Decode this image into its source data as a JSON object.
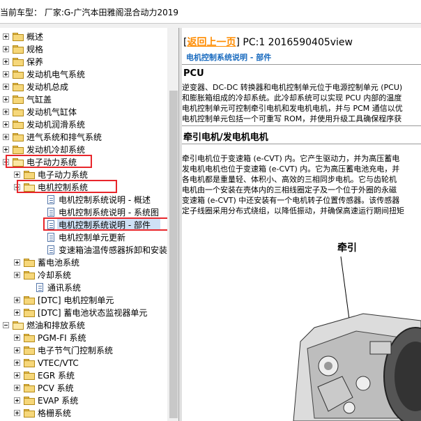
{
  "window": {
    "title": "当前车型： 厂家:G-广汽本田雅阁混合动力2019"
  },
  "tree": [
    {
      "label": "概述",
      "type": "folder",
      "expander": "plus",
      "depth": 0
    },
    {
      "label": "规格",
      "type": "folder",
      "expander": "plus",
      "depth": 0
    },
    {
      "label": "保养",
      "type": "folder",
      "expander": "plus",
      "depth": 0
    },
    {
      "label": "发动机电气系统",
      "type": "folder",
      "expander": "plus",
      "depth": 0
    },
    {
      "label": "发动机总成",
      "type": "folder",
      "expander": "plus",
      "depth": 0
    },
    {
      "label": "气缸盖",
      "type": "folder",
      "expander": "plus",
      "depth": 0
    },
    {
      "label": "发动机气缸体",
      "type": "folder",
      "expander": "plus",
      "depth": 0
    },
    {
      "label": "发动机润滑系统",
      "type": "folder",
      "expander": "plus",
      "depth": 0
    },
    {
      "label": "进气系统和排气系统",
      "type": "folder",
      "expander": "plus",
      "depth": 0
    },
    {
      "label": "发动机冷却系统",
      "type": "folder",
      "expander": "plus",
      "depth": 0
    },
    {
      "label": "电子动力系统",
      "type": "folder",
      "expander": "minus",
      "depth": 0,
      "open": true,
      "boxed": true
    },
    {
      "label": "电子动力系统",
      "type": "folder",
      "expander": "plus",
      "depth": 1
    },
    {
      "label": "电机控制系统",
      "type": "folder",
      "expander": "minus",
      "depth": 1,
      "open": true,
      "boxed": true
    },
    {
      "label": "电机控制系统说明 - 概述",
      "type": "doc",
      "depth": 2
    },
    {
      "label": "电机控制系统说明 - 系统图",
      "type": "doc",
      "depth": 2
    },
    {
      "label": "电机控制系统说明 - 部件",
      "type": "doc",
      "depth": 2,
      "selected": true,
      "boxed": true
    },
    {
      "label": "电机控制单元更新",
      "type": "doc",
      "depth": 2
    },
    {
      "label": "变速箱油温传感器拆卸和安装",
      "type": "doc",
      "depth": 2
    },
    {
      "label": "蓄电池系统",
      "type": "folder",
      "expander": "plus",
      "depth": 1
    },
    {
      "label": "冷却系统",
      "type": "folder",
      "expander": "plus",
      "depth": 1
    },
    {
      "label": "通讯系统",
      "type": "doc",
      "depth": 1
    },
    {
      "label": "[DTC] 电机控制单元",
      "type": "folder",
      "expander": "plus",
      "depth": 1
    },
    {
      "label": "[DTC] 蓄电池状态监视器单元",
      "type": "folder",
      "expander": "plus",
      "depth": 1
    },
    {
      "label": "燃油和排放系统",
      "type": "folder",
      "expander": "minus",
      "depth": 0,
      "open": true
    },
    {
      "label": "PGM-FI 系统",
      "type": "folder",
      "expander": "plus",
      "depth": 1
    },
    {
      "label": "电子节气门控制系统",
      "type": "folder",
      "expander": "plus",
      "depth": 1
    },
    {
      "label": "VTEC/VTC",
      "type": "folder",
      "expander": "plus",
      "depth": 1
    },
    {
      "label": "EGR 系统",
      "type": "folder",
      "expander": "plus",
      "depth": 1
    },
    {
      "label": "PCV 系统",
      "type": "folder",
      "expander": "plus",
      "depth": 1
    },
    {
      "label": "EVAP 系统",
      "type": "folder",
      "expander": "plus",
      "depth": 1
    },
    {
      "label": "格栅系统",
      "type": "folder",
      "expander": "plus",
      "depth": 1
    }
  ],
  "content": {
    "nav_link": "返回上一页",
    "nav_text": "PC:1 2016590405view",
    "subtitle": "电机控制系统说明 - 部件",
    "section1_title": "PCU",
    "section1_lines": [
      "逆变器、DC-DC 转换器和电机控制单元位于电源控制单元 (PCU)",
      "和膨胀箱组成的冷却系统。此冷却系统可以实现 PCU 内部的温度",
      "电机控制单元可控制牵引电机和发电机电机，并与 PCM 通信以优",
      "电机控制单元包括一个可重写 ROM，并使用升级工具确保程序获"
    ],
    "section2_title": "牵引电机/发电机电机",
    "section2_lines": [
      "牵引电机位于变速箱 (e-CVT) 内。它产生驱动力，并为高压蓄电",
      "发电机电机也位于变速箱 (e-CVT) 内。它为高压蓄电池充电，并",
      "各电机都是重量轻、体积小、高效的三相同步电机。它与齿轮机",
      "电机由一个安装在壳体内的三相线圈定子及一个位于外圈的永磁",
      "变速箱 (e-CVT) 中还安装有一个电机转子位置传感器。该传感器",
      "定子线圈采用分布式绕组，以降低振动，并确保高速运行期间扭矩"
    ],
    "figure_label": "牵引"
  },
  "colors": {
    "accent_red": "#e8262b",
    "link_orange": "#ff8c00",
    "subtitle_blue": "#1a6bbf"
  }
}
